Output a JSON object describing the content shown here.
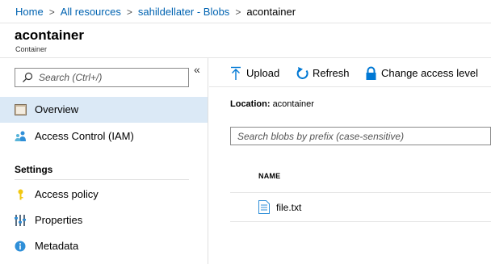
{
  "breadcrumb": {
    "items": [
      "Home",
      "All resources",
      "sahildellater - Blobs"
    ],
    "current": "acontainer",
    "separator": ">"
  },
  "header": {
    "title": "acontainer",
    "subtitle": "Container"
  },
  "sidebar": {
    "search_placeholder": "Search (Ctrl+/)",
    "collapse_glyph": "«",
    "items": [
      {
        "label": "Overview",
        "icon": "overview-icon",
        "selected": true
      },
      {
        "label": "Access Control (IAM)",
        "icon": "iam-icon",
        "selected": false
      }
    ],
    "section_label": "Settings",
    "settings_items": [
      {
        "label": "Access policy",
        "icon": "key-icon"
      },
      {
        "label": "Properties",
        "icon": "properties-icon"
      },
      {
        "label": "Metadata",
        "icon": "info-icon"
      }
    ]
  },
  "toolbar": {
    "upload_label": "Upload",
    "refresh_label": "Refresh",
    "change_access_label": "Change access level"
  },
  "main": {
    "location_label": "Location:",
    "location_value": "acontainer",
    "blob_search_placeholder": "Search blobs by prefix (case-sensitive)",
    "column_name": "NAME",
    "files": [
      {
        "name": "file.txt",
        "icon": "file-icon"
      }
    ]
  },
  "colors": {
    "link": "#0063b1",
    "accent": "#0078d4",
    "selected_bg": "#dbe9f6"
  }
}
